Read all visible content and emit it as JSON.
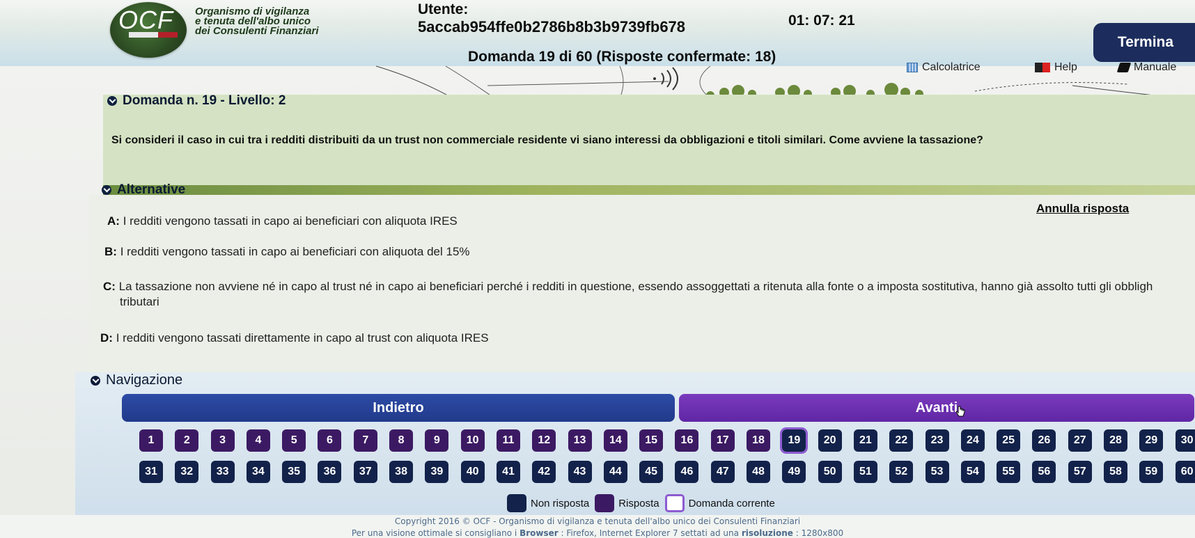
{
  "header": {
    "logo_text": "OCF",
    "org_line1": "Organismo di vigilanza",
    "org_line2": "e tenuta dell'albo unico",
    "org_line3": "dei Consulenti Finanziari",
    "user_label": "Utente:",
    "user_id": "5accab954ffe0b2786b8b3b9739fb678",
    "timer": "01: 07: 21",
    "termina_label": "Termina",
    "question_counter": "Domanda 19 di 60 (Risposte confermate: 18)",
    "tools": {
      "calculator_label": "Calcolatrice",
      "calculator_icon": "calculator-icon",
      "help_label": "Help",
      "help_icon": "flag-icon",
      "manual_label": "Manuale",
      "manual_icon": "book-icon"
    }
  },
  "question": {
    "heading": "Domanda n. 19 - Livello: 2",
    "text": "Si consideri il caso in cui tra i redditi distribuiti da un trust non commerciale residente vi siano interessi da obbligazioni e titoli similari. Come avviene la tassazione?"
  },
  "alternatives": {
    "heading": "Alternative",
    "annulla_label": "Annulla risposta",
    "items": [
      {
        "letter": "A:",
        "text": "I redditi vengono tassati in capo ai beneficiari con aliquota IRES"
      },
      {
        "letter": "B:",
        "text": "I redditi vengono tassati in capo ai beneficiari con aliquota del 15%"
      },
      {
        "letter": "C:",
        "text": "La tassazione non avviene né in capo al trust né in capo ai beneficiari perché i redditi in questione, essendo assoggettati a ritenuta alla fonte o a imposta sostitutiva, hanno già assolto tutti gli obbligh",
        "continuation": "tributari"
      },
      {
        "letter": "D:",
        "text": "I redditi vengono tassati direttamente in capo al trust con aliquota IRES"
      }
    ]
  },
  "navigation": {
    "heading": "Navigazione",
    "back_label": "Indietro",
    "next_label": "Avanti",
    "current_question": 19,
    "questions_row1": [
      "1",
      "2",
      "3",
      "4",
      "5",
      "6",
      "7",
      "8",
      "9",
      "10",
      "11",
      "12",
      "13",
      "14",
      "15",
      "16",
      "17",
      "18",
      "19",
      "20",
      "21",
      "22",
      "23",
      "24",
      "25",
      "26",
      "27",
      "28",
      "29",
      "30"
    ],
    "questions_row2": [
      "31",
      "32",
      "33",
      "34",
      "35",
      "36",
      "37",
      "38",
      "39",
      "40",
      "41",
      "42",
      "43",
      "44",
      "45",
      "46",
      "47",
      "48",
      "49",
      "50",
      "51",
      "52",
      "53",
      "54",
      "55",
      "56",
      "57",
      "58",
      "59",
      "60"
    ],
    "answered": [
      "1",
      "2",
      "3",
      "4",
      "5",
      "6",
      "7",
      "8",
      "9",
      "10",
      "11",
      "12",
      "13",
      "14",
      "15",
      "16",
      "17",
      "18"
    ],
    "legend": {
      "unanswered_label": "Non risposta",
      "answered_label": "Risposta",
      "current_label": "Domanda corrente"
    }
  },
  "colors": {
    "unanswered": "#12224a",
    "answered": "#3c1a63",
    "current_outline": "#8d5bd0",
    "back_button": "#213a8a",
    "next_button": "#6026a4"
  },
  "footer": {
    "copyright": "Copyright 2016 © OCF - Organismo di vigilanza e tenuta dell'albo unico dei Consulenti Finanziari",
    "browser_note_prefix": "Per una visione ottimale si consigliano i",
    "browser_label": "Browser",
    "browser_note_mid": ": Firefox, Internet Explorer 7 settati ad una",
    "resolution_label": "risoluzione",
    "resolution_value": ": 1280x800"
  }
}
